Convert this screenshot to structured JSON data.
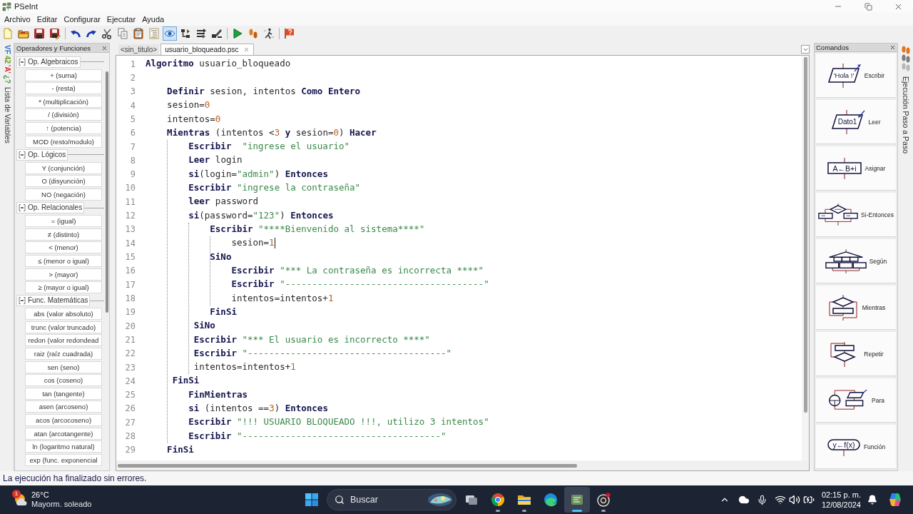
{
  "window": {
    "title": "PSeInt"
  },
  "menu": [
    "Archivo",
    "Editar",
    "Configurar",
    "Ejecutar",
    "Ayuda"
  ],
  "toolbar": {
    "groups": [
      {
        "buttons": [
          {
            "kind": "new",
            "on": false
          },
          {
            "kind": "open",
            "on": false
          },
          {
            "kind": "save",
            "on": false
          },
          {
            "kind": "saveas",
            "on": false
          }
        ]
      },
      {
        "buttons": [
          {
            "kind": "undo",
            "on": false
          },
          {
            "kind": "redo",
            "on": false
          },
          {
            "kind": "cut",
            "on": false
          },
          {
            "kind": "copy",
            "on": false
          },
          {
            "kind": "paste",
            "on": false
          },
          {
            "kind": "indent",
            "on": false
          },
          {
            "kind": "preview",
            "on": true
          },
          {
            "kind": "flow",
            "on": false
          },
          {
            "kind": "convert",
            "on": false
          },
          {
            "kind": "draw",
            "on": false
          }
        ]
      },
      {
        "buttons": [
          {
            "kind": "run",
            "on": false
          },
          {
            "kind": "step",
            "on": false
          },
          {
            "kind": "debug",
            "on": false
          }
        ]
      },
      {
        "buttons": [
          {
            "kind": "help",
            "on": false
          }
        ]
      }
    ]
  },
  "variables_strip": {
    "symbols": [
      {
        "text": "VF",
        "color": "#2f6fc0"
      },
      {
        "text": "42",
        "color": "#6a9a20"
      },
      {
        "text": "'A'",
        "color": "#d03030"
      },
      {
        "text": "¿?",
        "color": "#3a9a3a"
      }
    ],
    "label": "Lista de Variables"
  },
  "operators_panel": {
    "title": "Operadores y Funciones",
    "groups": [
      {
        "label": "Op. Algebraicos",
        "expanded": true,
        "items": [
          "+ (suma)",
          "- (resta)",
          "* (multiplicación)",
          "/ (división)",
          "↑ (potencia)",
          "MOD (resto/modulo)"
        ]
      },
      {
        "label": "Op. Lógicos",
        "expanded": true,
        "items": [
          "Y (conjunción)",
          "O (disyunción)",
          "NO (negación)"
        ]
      },
      {
        "label": "Op. Relacionales",
        "expanded": true,
        "items": [
          "= (igual)",
          "≠ (distinto)",
          "< (menor)",
          "≤ (menor o igual)",
          "> (mayor)",
          "≥ (mayor o igual)"
        ]
      },
      {
        "label": "Func. Matemáticas",
        "expanded": true,
        "items": [
          "abs (valor absoluto)",
          "trunc (valor truncado)",
          "redon (valor redondead",
          "raiz (raíz cuadrada)",
          "sen (seno)",
          "cos (coseno)",
          "tan (tangente)",
          "asen (arcoseno)",
          "acos (arcocoseno)",
          "atan (arcotangente)",
          "ln (logaritmo natural)",
          "exp (func. exponencial"
        ]
      }
    ]
  },
  "editor": {
    "tabs": [
      {
        "label": "<sin_titulo>",
        "selected": false
      },
      {
        "label": "usuario_bloqueado.psc",
        "selected": true
      }
    ],
    "lines": [
      {
        "number": "1",
        "caret": false,
        "tokens": [
          {
            "kind": "keyword",
            "text": "Algoritmo"
          },
          {
            "kind": "text",
            "text": " usuario_bloqueado"
          }
        ]
      },
      {
        "number": "2",
        "caret": false
      },
      {
        "number": "3",
        "caret": false,
        "tokens": [
          {
            "kind": "keyword",
            "text": "    Definir"
          },
          {
            "kind": "text",
            "text": " sesion, intentos "
          },
          {
            "kind": "keyword",
            "text": "Como "
          },
          {
            "kind": "keyword",
            "text": "Entero"
          }
        ]
      },
      {
        "number": "4",
        "caret": false,
        "tokens": [
          {
            "kind": "text",
            "text": "    sesion="
          },
          {
            "kind": "number",
            "text": "0"
          }
        ]
      },
      {
        "number": "5",
        "caret": false,
        "tokens": [
          {
            "kind": "text",
            "text": "    intentos="
          },
          {
            "kind": "number",
            "text": "0"
          }
        ]
      },
      {
        "number": "6",
        "caret": false,
        "tokens": [
          {
            "kind": "keyword",
            "text": "    Mientras"
          },
          {
            "kind": "text",
            "text": " (intentos <"
          },
          {
            "kind": "number",
            "text": "3"
          },
          {
            "kind": "keyword",
            "text": " y"
          },
          {
            "kind": "text",
            "text": " sesion="
          },
          {
            "kind": "number",
            "text": "0"
          },
          {
            "kind": "text",
            "text": ") "
          },
          {
            "kind": "keyword",
            "text": "Hacer"
          }
        ]
      },
      {
        "number": "7",
        "caret": false,
        "tokens": [
          {
            "kind": "keyword",
            "text": "        Escribir  "
          },
          {
            "kind": "string",
            "text": "\"ingrese el usuario\""
          }
        ]
      },
      {
        "number": "8",
        "caret": false,
        "tokens": [
          {
            "kind": "keyword",
            "text": "        Leer"
          },
          {
            "kind": "text",
            "text": " login"
          }
        ]
      },
      {
        "number": "9",
        "caret": false,
        "tokens": [
          {
            "kind": "keyword",
            "text": "        si"
          },
          {
            "kind": "text",
            "text": "(login="
          },
          {
            "kind": "string",
            "text": "\"admin\""
          },
          {
            "kind": "text",
            "text": ") "
          },
          {
            "kind": "keyword",
            "text": "Entonces"
          }
        ]
      },
      {
        "number": "10",
        "caret": false,
        "tokens": [
          {
            "kind": "keyword",
            "text": "        Escribir "
          },
          {
            "kind": "string",
            "text": "\"ingrese la contraseña\""
          }
        ]
      },
      {
        "number": "11",
        "caret": false,
        "tokens": [
          {
            "kind": "keyword",
            "text": "        leer"
          },
          {
            "kind": "text",
            "text": " password"
          }
        ]
      },
      {
        "number": "12",
        "caret": false,
        "tokens": [
          {
            "kind": "keyword",
            "text": "        si"
          },
          {
            "kind": "text",
            "text": "(password="
          },
          {
            "kind": "string",
            "text": "\"123\""
          },
          {
            "kind": "text",
            "text": ") "
          },
          {
            "kind": "keyword",
            "text": "Entonces"
          }
        ]
      },
      {
        "number": "13",
        "caret": false,
        "tokens": [
          {
            "kind": "keyword",
            "text": "            Escribir "
          },
          {
            "kind": "string",
            "text": "\"****Bienvenido al sistema****\""
          }
        ]
      },
      {
        "number": "14",
        "caret": true,
        "tokens": [
          {
            "kind": "text",
            "text": "                sesion="
          },
          {
            "kind": "number",
            "text": "1"
          }
        ]
      },
      {
        "number": "15",
        "caret": false,
        "tokens": [
          {
            "kind": "keyword",
            "text": "            SiNo"
          }
        ]
      },
      {
        "number": "16",
        "caret": false,
        "tokens": [
          {
            "kind": "keyword",
            "text": "                Escribir "
          },
          {
            "kind": "string",
            "text": "\"*** La contraseña es incorrecta ****\""
          }
        ]
      },
      {
        "number": "17",
        "caret": false,
        "tokens": [
          {
            "kind": "keyword",
            "text": "                Escribir "
          },
          {
            "kind": "string",
            "text": "\"-------------------------------------\""
          }
        ]
      },
      {
        "number": "18",
        "caret": false,
        "tokens": [
          {
            "kind": "text",
            "text": "                intentos=intentos+"
          },
          {
            "kind": "number",
            "text": "1"
          }
        ]
      },
      {
        "number": "19",
        "caret": false,
        "tokens": [
          {
            "kind": "keyword",
            "text": "            FinSi"
          }
        ]
      },
      {
        "number": "20",
        "caret": false,
        "tokens": [
          {
            "kind": "keyword",
            "text": "         SiNo"
          }
        ]
      },
      {
        "number": "21",
        "caret": false,
        "tokens": [
          {
            "kind": "keyword",
            "text": "         Escribir "
          },
          {
            "kind": "string",
            "text": "\"*** El usuario es incorrecto ****\""
          }
        ]
      },
      {
        "number": "22",
        "caret": false,
        "tokens": [
          {
            "kind": "keyword",
            "text": "         Escribir "
          },
          {
            "kind": "string",
            "text": "\"-------------------------------------\""
          }
        ]
      },
      {
        "number": "23",
        "caret": false,
        "tokens": [
          {
            "kind": "text",
            "text": "         intentos=intentos+"
          },
          {
            "kind": "number",
            "text": "1"
          }
        ]
      },
      {
        "number": "24",
        "caret": false,
        "tokens": [
          {
            "kind": "keyword",
            "text": "     FinSi"
          }
        ]
      },
      {
        "number": "25",
        "caret": false,
        "tokens": [
          {
            "kind": "keyword",
            "text": "        FinMientras"
          }
        ]
      },
      {
        "number": "26",
        "caret": false,
        "tokens": [
          {
            "kind": "keyword",
            "text": "        si"
          },
          {
            "kind": "text",
            "text": " (intentos =="
          },
          {
            "kind": "number",
            "text": "3"
          },
          {
            "kind": "text",
            "text": ") "
          },
          {
            "kind": "keyword",
            "text": "Entonces"
          }
        ]
      },
      {
        "number": "27",
        "caret": false,
        "tokens": [
          {
            "kind": "keyword",
            "text": "        Escribir "
          },
          {
            "kind": "string",
            "text": "\"!!! USUARIO BLOQUEADO !!!, utilizo 3 intentos\""
          }
        ]
      },
      {
        "number": "28",
        "caret": false,
        "tokens": [
          {
            "kind": "keyword",
            "text": "        Escribir "
          },
          {
            "kind": "string",
            "text": "\"-------------------------------------\""
          }
        ]
      },
      {
        "number": "29",
        "caret": false,
        "tokens": [
          {
            "kind": "keyword",
            "text": "    FinSi"
          }
        ]
      }
    ]
  },
  "commands_panel": {
    "title": "Comandos",
    "items": [
      {
        "kind": "write",
        "label": "Escribir",
        "symbol_text": "'Hola !'"
      },
      {
        "kind": "read",
        "label": "Leer",
        "symbol_text": "Dato1"
      },
      {
        "kind": "assign",
        "label": "Asignar",
        "symbol_text": "A←B+i"
      },
      {
        "kind": "if",
        "label": "Si-Entonces"
      },
      {
        "kind": "switch",
        "label": "Según"
      },
      {
        "kind": "while",
        "label": "Mientras"
      },
      {
        "kind": "repeat",
        "label": "Repetir"
      },
      {
        "kind": "for",
        "label": "Para"
      },
      {
        "kind": "function",
        "label": "Función",
        "symbol_text": "y←f(x)"
      }
    ]
  },
  "step_panel": {
    "label": "Ejecución Paso a Paso"
  },
  "status_bar": {
    "message": "La ejecución ha finalizado sin errores."
  },
  "taskbar": {
    "weather": {
      "badge": "1",
      "temperature": "26°C",
      "condition": "Mayorm. soleado"
    },
    "search": {
      "placeholder": "Buscar"
    },
    "apps": [
      {
        "kind": "taskview",
        "open": false,
        "active": false
      },
      {
        "kind": "browser",
        "open": true,
        "active": false
      },
      {
        "kind": "files",
        "open": true,
        "active": false
      },
      {
        "kind": "web",
        "open": false,
        "active": false
      },
      {
        "kind": "editor",
        "open": true,
        "active": true
      },
      {
        "kind": "recorder",
        "open": true,
        "active": false
      }
    ],
    "clock": {
      "time": "02:15 p. m.",
      "date": "12/08/2024"
    }
  }
}
